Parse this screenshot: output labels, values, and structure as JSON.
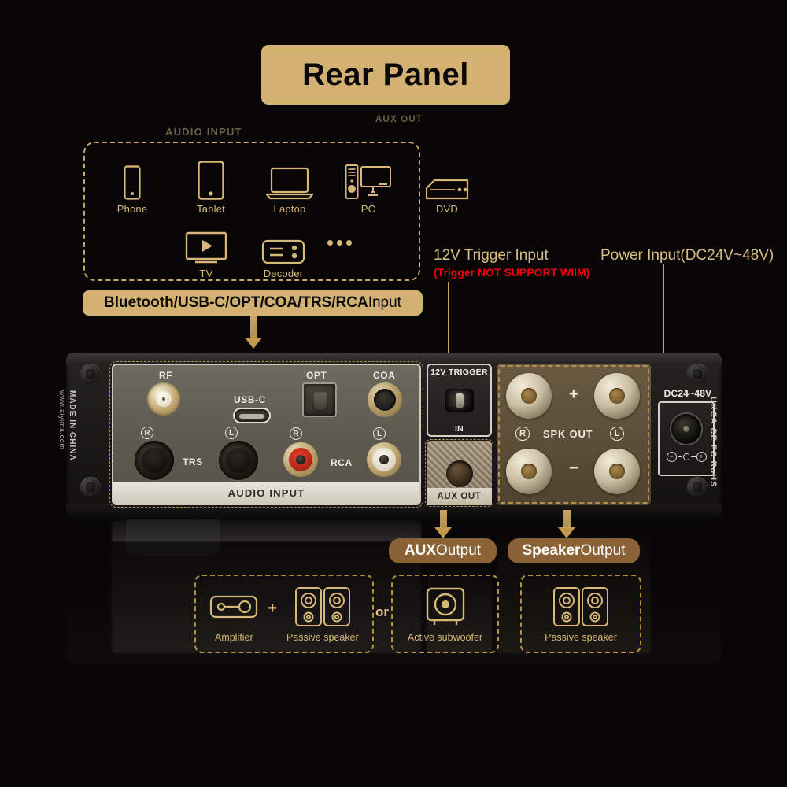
{
  "header": {
    "title": "Rear Panel",
    "banner_color": "#d3b172"
  },
  "sources": {
    "row1": [
      {
        "label": "Phone",
        "icon": "phone-icon"
      },
      {
        "label": "Tablet",
        "icon": "tablet-icon"
      },
      {
        "label": "Laptop",
        "icon": "laptop-icon"
      },
      {
        "label": "PC",
        "icon": "pc-icon"
      },
      {
        "label": "DVD",
        "icon": "dvd-player-icon"
      }
    ],
    "row2": [
      {
        "label": "TV",
        "icon": "tv-icon"
      },
      {
        "label": "Decoder",
        "icon": "decoder-icon"
      }
    ],
    "more_icon": "ellipsis-icon"
  },
  "callouts": {
    "input_pill_bold": "Bluetooth/USB-C/OPT/COA/TRS/RCA",
    "input_pill_light": " Input",
    "trigger_label": "12V Trigger Input",
    "trigger_warning": "(Trigger NOT SUPPORT WIIM)",
    "trigger_warning_color": "#f0000f",
    "power_label": "Power Input(DC24V~48V)",
    "aux_output_bold": "AUX",
    "aux_output_light": " Output",
    "speaker_output_bold": "Speaker",
    "speaker_output_light": " Output",
    "output_pill_color": "#8a6235"
  },
  "device": {
    "side_brand": "MADE IN CHINA",
    "side_url": "www.aiyima.com",
    "audio_input": {
      "footer": "AUDIO INPUT",
      "rf": "RF",
      "usbc": "USB-C",
      "opt": "OPT",
      "coa": "COA",
      "trs": "TRS",
      "rca": "RCA",
      "trs_right": "R",
      "trs_left": "L",
      "rca_right": "R",
      "rca_left": "L"
    },
    "trigger": {
      "title": "12V TRIGGER",
      "direction": "IN"
    },
    "aux": {
      "footer": "AUX OUT"
    },
    "speaker": {
      "title": "SPK OUT",
      "right": "R",
      "left": "L",
      "plus": "+",
      "minus": "−"
    },
    "power": {
      "voltage": "DC24~48V",
      "certs": "UKCA  CE  FC  RoHS"
    }
  },
  "equipment": {
    "left": {
      "items": [
        {
          "label": "Amplifier",
          "icon": "amplifier-icon"
        },
        {
          "label": "Passive speaker",
          "icon": "passive-speaker-pair-icon"
        }
      ],
      "connector": "+"
    },
    "divider": "or",
    "mid": {
      "items": [
        {
          "label": "Active subwoofer",
          "icon": "subwoofer-icon"
        }
      ]
    },
    "right": {
      "items": [
        {
          "label": "Passive speaker",
          "icon": "passive-speaker-pair-icon"
        }
      ]
    }
  }
}
